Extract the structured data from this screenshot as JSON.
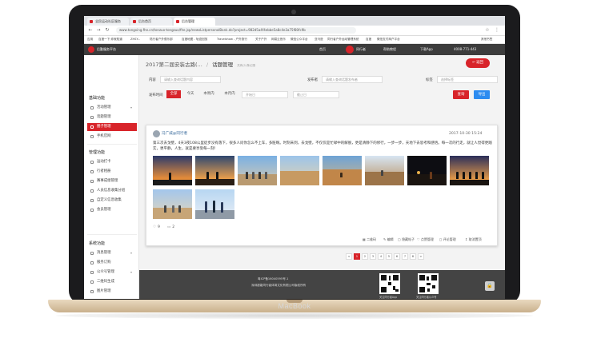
{
  "device": {
    "brand": "MacBook"
  },
  "browser": {
    "tabs": [
      {
        "label": "全民运动社区服务"
      },
      {
        "label": "后台首页"
      },
      {
        "label": "后台管理"
      }
    ],
    "url": "www.tongxing.fhe.cn/tonzuo-tongzuo/fhe.jsp/newsListpersonalBank.do?project=982d5a4f4ebbe5a8c4e3a75f80fc9b",
    "bookmarks": [
      "应用",
      "百度一下,你就知道",
      "ZHSY...",
      "陆行者户外俱乐部",
      "百度地图 - 轨迹回放",
      "Travelshow - 户外旅行",
      "关于户外",
      "网易云音乐",
      "微信公众平台",
      "亚马逊",
      "同行者户外运动管理系统",
      "百度",
      "微信支付商户平台",
      "其他书签"
    ]
  },
  "header": {
    "app_name": "后勤服务平台",
    "nav": [
      "首页",
      "同行者",
      "帮助教程",
      "下载App",
      "4008-771-443"
    ]
  },
  "sidebar": {
    "group1": "基础功能",
    "items1": [
      "活动管理",
      "话题管理",
      "圈子管理",
      "手机官网"
    ],
    "group2": "管理功能",
    "items2": [
      "运动打卡",
      "行者相册",
      "赛事成绩管理",
      "人员信息收集分组",
      "自定义信息收集",
      "会员管理"
    ],
    "group3": "系统功能",
    "items3": [
      "消息管理",
      "服务订购",
      "公众号管理",
      "二维码生成",
      "图片管理"
    ]
  },
  "main": {
    "breadcrumb_parent": "2017第二届安装古路(...",
    "breadcrumb_sep": "/",
    "breadcrumb_current": "话题管理",
    "breadcrumb_sub": "共有(1)条记录",
    "back_label": "返回",
    "filter": {
      "content_label": "内容",
      "content_placeholder": "请输入查询话题内容",
      "publisher_label": "发布者",
      "publisher_placeholder": "请输入查询话题发布者",
      "tag_label": "标签",
      "tag_placeholder": "选择标签",
      "time_label": "发布时间",
      "time_options": [
        "全部",
        "今天",
        "本周内",
        "本月内"
      ],
      "start_placeholder": "开始日",
      "end_placeholder": "截止日",
      "query_label": "查询",
      "export_label": "导出"
    },
    "post": {
      "author": "冯广威@同行者",
      "time": "2017-10-30 15:24",
      "text": "第三次去戈壁，4天3夜108公里徒步没有落下，很多人问你怎么不上车，多脏啊。时刻未到，去戈壁，不仅仅是忙碌中的解脱，更是清静下的修行，一步一步，天地下去思考和感悟。每一次的行走，就让人觉得更踏实，更平静，人生，就是要享受每一刻！",
      "likes": "9",
      "comments": "2",
      "actions": [
        "二维码",
        "编辑",
        "隐藏帖子",
        "点赞管理",
        "评论管理",
        "取消置顶"
      ]
    },
    "pager": [
      "<",
      "1",
      "2",
      "3",
      "4",
      "5",
      "6",
      "7",
      "8",
      ">"
    ]
  },
  "footer": {
    "icp": "粤ICP备16040595号-1",
    "company": "深圳超能同行者体育文化有限公司版权所有",
    "qr1_caption": "关注同行者App",
    "qr2_caption": "关注同行者公众号"
  },
  "colors": {
    "accent": "#d8242a",
    "header_bg": "#3c3c3c",
    "footer_bg": "#444444",
    "export_btn": "#2d8cf0"
  }
}
